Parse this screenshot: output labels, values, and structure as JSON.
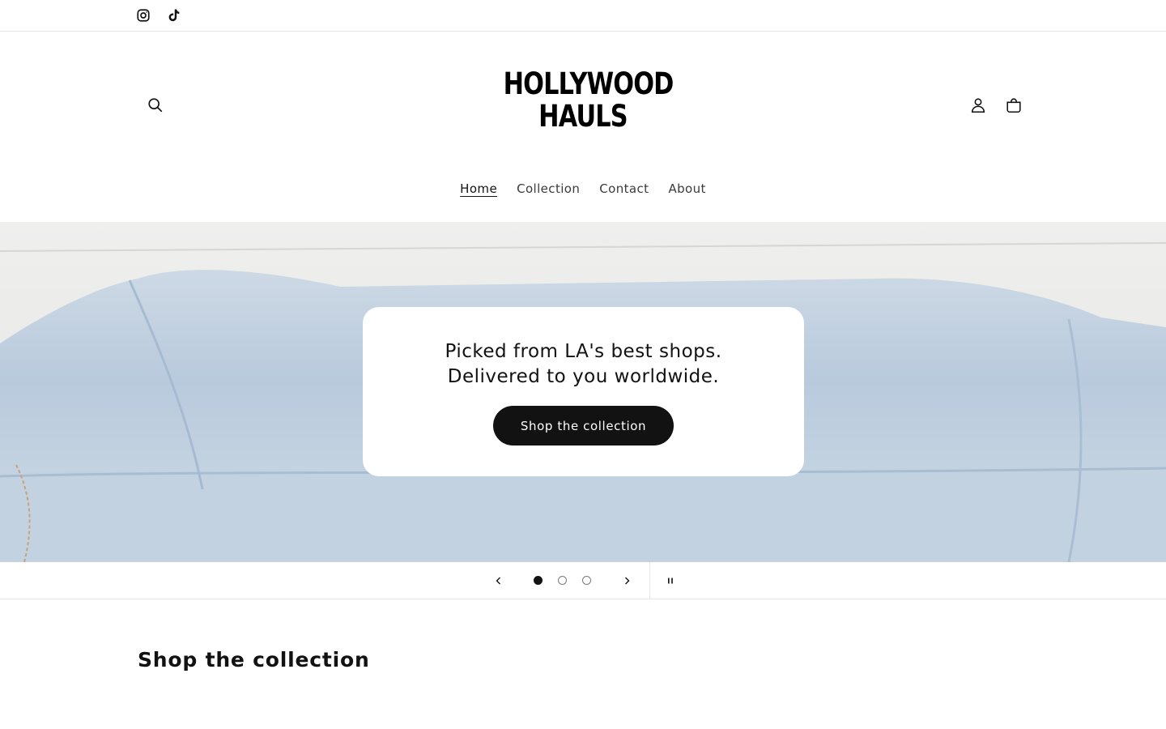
{
  "social": {
    "instagram_icon": "instagram-icon",
    "tiktok_icon": "tiktok-icon"
  },
  "header": {
    "logo_line1": "HOLLYWOOD",
    "logo_line2": "HAULS",
    "search_icon": "search-icon",
    "account_icon": "account-icon",
    "cart_icon": "cart-icon"
  },
  "nav": {
    "items": [
      {
        "label": "Home",
        "active": true
      },
      {
        "label": "Collection",
        "active": false
      },
      {
        "label": "Contact",
        "active": false
      },
      {
        "label": "About",
        "active": false
      }
    ]
  },
  "hero": {
    "line1": "Picked from LA's best shops.",
    "line2": "Delivered to you worldwide.",
    "button_label": "Shop the collection"
  },
  "slider": {
    "slide_count": 3,
    "current_slide": 1,
    "prev_icon": "chevron-left-icon",
    "next_icon": "chevron-right-icon",
    "pause_icon": "pause-icon"
  },
  "collection": {
    "title": "Shop the collection"
  },
  "colors": {
    "text": "#121212",
    "button_bg": "#121212",
    "border": "#e6e6e6",
    "hero_denim": "#bccddf"
  }
}
